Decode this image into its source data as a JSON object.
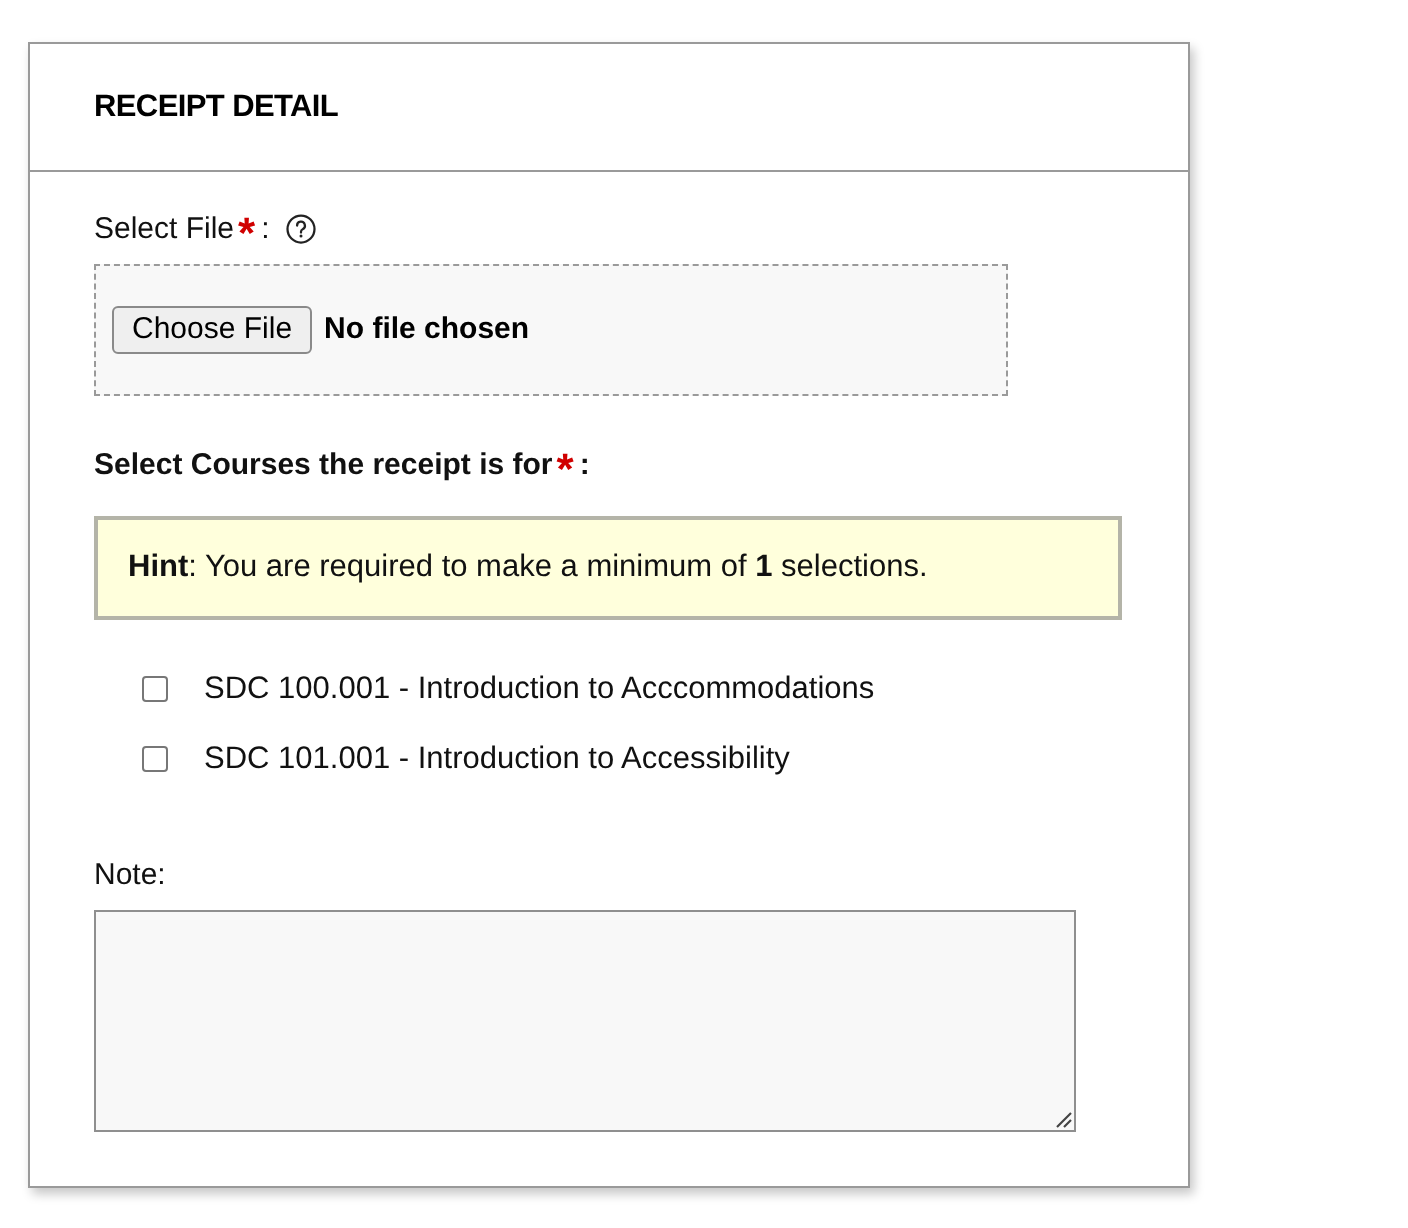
{
  "card": {
    "title": "RECEIPT DETAIL"
  },
  "file_field": {
    "label": "Select File",
    "required_mark": "*",
    "label_suffix": ":",
    "button": "Choose File",
    "status": "No file chosen"
  },
  "courses_field": {
    "label": "Select Courses the receipt is for",
    "required_mark": "*",
    "label_suffix": ":",
    "hint": "**Hint**: You are required to make a minimum of **1** selections.",
    "options": [
      {
        "label": "SDC 100.001 - Introduction to Acccommodations",
        "checked": false
      },
      {
        "label": "SDC 101.001 - Introduction to Accessibility",
        "checked": false
      }
    ]
  },
  "note_field": {
    "label": "Note:"
  }
}
